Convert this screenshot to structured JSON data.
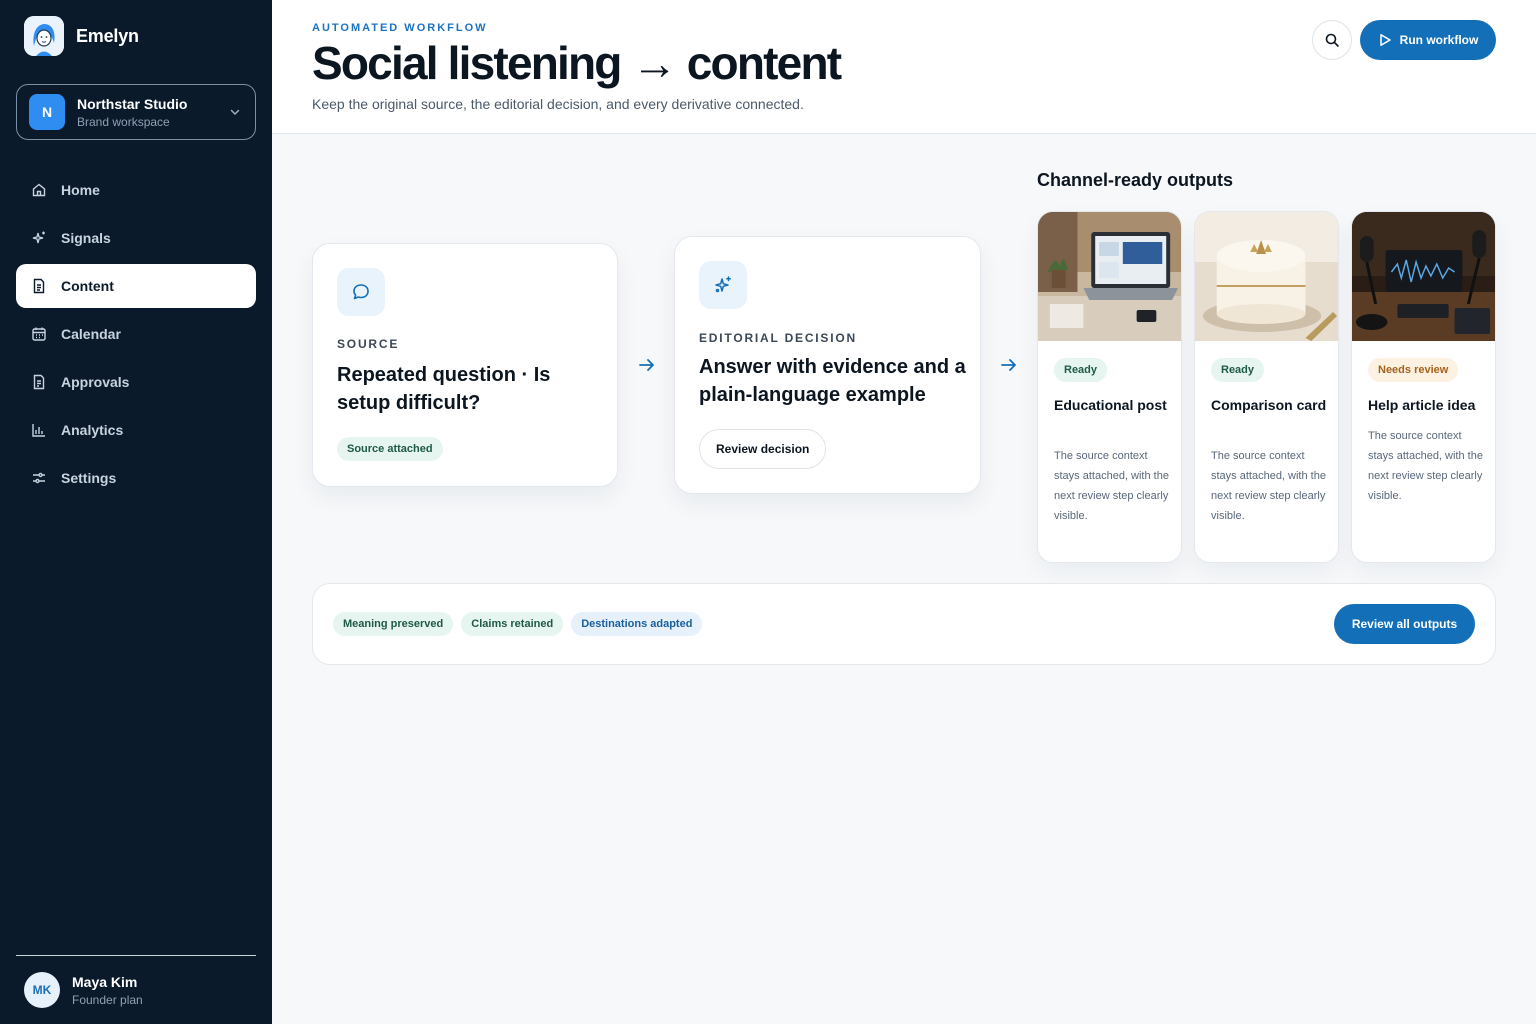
{
  "app": {
    "name": "Emelyn"
  },
  "workspace": {
    "initial": "N",
    "name": "Northstar Studio",
    "subtitle": "Brand workspace"
  },
  "nav": [
    {
      "label": "Home",
      "icon": "home-icon",
      "active": false
    },
    {
      "label": "Signals",
      "icon": "sparkles-icon",
      "active": false
    },
    {
      "label": "Content",
      "icon": "document-icon",
      "active": true
    },
    {
      "label": "Calendar",
      "icon": "calendar-icon",
      "active": false
    },
    {
      "label": "Approvals",
      "icon": "approval-document-icon",
      "active": false
    },
    {
      "label": "Analytics",
      "icon": "bar-chart-icon",
      "active": false
    },
    {
      "label": "Settings",
      "icon": "sliders-icon",
      "active": false
    }
  ],
  "user": {
    "initials": "MK",
    "name": "Maya Kim",
    "plan": "Founder plan"
  },
  "header": {
    "eyebrow": "AUTOMATED WORKFLOW",
    "title": "Social listening → content",
    "subtitle": "Keep the original source, the editorial decision, and every derivative connected.",
    "run_label": "Run workflow"
  },
  "source": {
    "label": "SOURCE",
    "title": "Repeated question · Is setup difficult?",
    "badge": "Source attached",
    "icon": "chat-bubble-icon"
  },
  "decision": {
    "label": "EDITORIAL DECISION",
    "title": "Answer with evidence and a plain-language example",
    "button": "Review decision",
    "icon": "sparkles-icon"
  },
  "outputs": {
    "heading": "Channel-ready outputs",
    "items": [
      {
        "status": "Ready",
        "status_tone": "green",
        "title": "Educational post",
        "description": "The source context stays attached, with the next review step clearly visible.",
        "image": "laptop-desk-photo"
      },
      {
        "status": "Ready",
        "status_tone": "green",
        "title": "Comparison card",
        "description": "The source context stays attached, with the next review step clearly visible.",
        "image": "cake-photo"
      },
      {
        "status": "Needs review",
        "status_tone": "amber",
        "title": "Help article idea",
        "description": "The source context stays attached, with the next review step clearly visible.",
        "image": "podcast-studio-photo"
      }
    ]
  },
  "footer": {
    "tags": [
      "Meaning preserved",
      "Claims retained",
      "Destinations adapted"
    ],
    "button": "Review all outputs"
  },
  "colors": {
    "sidebar": "#0b1a2a",
    "accent": "#126fb8",
    "ready": "#e6f5ef",
    "needs_review": "#fdf1e2"
  }
}
